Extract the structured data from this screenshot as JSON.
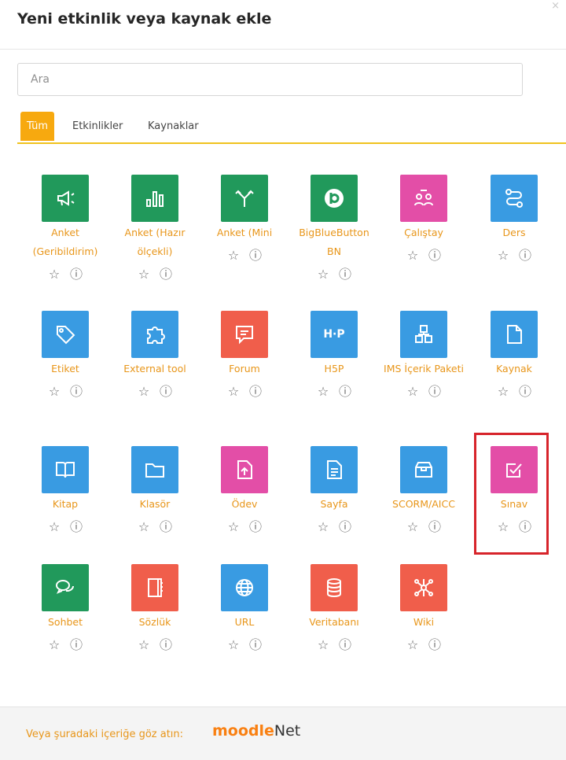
{
  "dialog": {
    "title": "Yeni etkinlik veya kaynak ekle",
    "close": "×"
  },
  "search": {
    "placeholder": "Ara"
  },
  "tabs": [
    "Tüm",
    "Etkinlikler",
    "Kaynaklar"
  ],
  "items": [
    {
      "label": "Anket (Geribildirim)",
      "icon": "megaphone-icon",
      "color": "#21995b"
    },
    {
      "label": "Anket (Hazır ölçekli)",
      "icon": "bar-chart-icon",
      "color": "#21995b"
    },
    {
      "label": "Anket (Mini",
      "icon": "choice-icon",
      "color": "#21995b"
    },
    {
      "label": "BigBlueButton BN",
      "icon": "bigbluebutton-icon",
      "color": "#21995b"
    },
    {
      "label": "Çalıştay",
      "icon": "workshop-icon",
      "color": "#e34ea7"
    },
    {
      "label": "Ders",
      "icon": "lesson-icon",
      "color": "#399be2"
    },
    {
      "label": "Etiket",
      "icon": "tag-icon",
      "color": "#399be2"
    },
    {
      "label": "External tool",
      "icon": "puzzle-icon",
      "color": "#399be2"
    },
    {
      "label": "Forum",
      "icon": "forum-icon",
      "color": "#f05e4b"
    },
    {
      "label": "H5P",
      "icon": "h5p-icon",
      "glyph": "H·P",
      "color": "#399be2"
    },
    {
      "label": "IMS İçerik Paketi",
      "icon": "ims-package-icon",
      "color": "#399be2"
    },
    {
      "label": "Kaynak",
      "icon": "file-icon",
      "color": "#399be2"
    },
    {
      "label": "Kitap",
      "icon": "book-icon",
      "color": "#399be2"
    },
    {
      "label": "Klasör",
      "icon": "folder-icon",
      "color": "#399be2"
    },
    {
      "label": "Ödev",
      "icon": "assignment-icon",
      "color": "#e34ea7"
    },
    {
      "label": "Sayfa",
      "icon": "page-icon",
      "color": "#399be2"
    },
    {
      "label": "SCORM/AICC",
      "icon": "scorm-icon",
      "color": "#399be2"
    },
    {
      "label": "Sınav",
      "icon": "quiz-icon",
      "color": "#e34ea7"
    },
    {
      "label": "Sohbet",
      "icon": "chat-icon",
      "color": "#21995b"
    },
    {
      "label": "Sözlük",
      "icon": "glossary-icon",
      "color": "#f05e4b"
    },
    {
      "label": "URL",
      "icon": "globe-icon",
      "color": "#399be2"
    },
    {
      "label": "Veritabanı",
      "icon": "database-icon",
      "color": "#f05e4b"
    },
    {
      "label": "Wiki",
      "icon": "wiki-icon",
      "color": "#f05e4b"
    }
  ],
  "actions": {
    "star": "☆",
    "info": "ⓘ"
  },
  "footer": {
    "text": "Veya şuradaki içeriğe göz atın:",
    "logo_moodle": "moodle",
    "logo_net": "Net"
  }
}
